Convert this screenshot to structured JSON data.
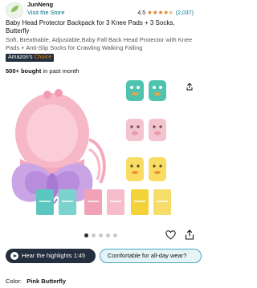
{
  "seller": {
    "name": "JunNeng",
    "link": "Visit the Store",
    "rating": "4.5",
    "ratings_count": "(2,037)",
    "stars": 4.5
  },
  "product": {
    "title": "Baby Head Protector Backpack for 3 Knee Pads + 3 Socks, Butterfly",
    "subtitle": "Soft, Breathable, Adjustable,Baby Fall Back Head Protector with Knee Pads + Anti-Slip Socks for Crawling Walking Falling",
    "badge_prefix": "Amazon's",
    "badge_suffix": "Choice",
    "bought_bold": "500+ bought",
    "bought_rest": " in past month"
  },
  "gallery": {
    "image_count": 5,
    "active_index": 0
  },
  "actions": {
    "highlights_label": "Hear the highlights 1:45",
    "question_label": "Comfortable for all-day wear?"
  },
  "variant": {
    "label": "Color:",
    "value": "Pink Butterfly"
  },
  "icons": {
    "share": "share-icon",
    "like": "heart-icon",
    "play": "play-icon"
  },
  "colors": {
    "link": "#007185",
    "star": "#de7921",
    "badge_bg": "#232f3e",
    "badge_accent": "#f08804",
    "question_border": "#4aa7c2"
  }
}
